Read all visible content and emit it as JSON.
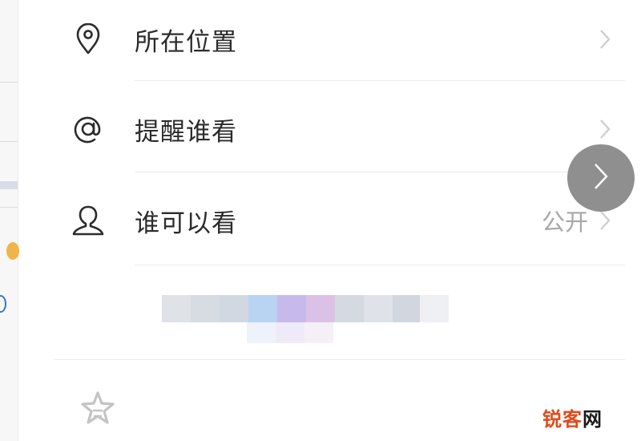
{
  "menu": {
    "location": {
      "label": "所在位置"
    },
    "mention": {
      "label": "提醒谁看"
    },
    "visibility": {
      "label": "谁可以看",
      "value": "公开"
    }
  },
  "floating_button": {
    "icon": "chevron-right-icon"
  },
  "blurred_content": {
    "row1_colors": [
      "#dfe2e7",
      "#d7dbe2",
      "#d2d8e1",
      "#b9d3f3",
      "#c8b9ec",
      "#dcc1e6",
      "#d5d9e0",
      "#dfe2e8",
      "#d2d7df",
      "#eef0f3"
    ],
    "row2_colors": [
      "#eef3fb",
      "#efeaf8",
      "#f5eff6"
    ]
  },
  "watermark": {
    "part1": "锐客",
    "part2": "网"
  },
  "colors": {
    "text": "#2b2b2b",
    "value_text": "#a8a8a8",
    "chevron": "#cfcfcf",
    "divider": "#ececec",
    "floating_button": "#8f8f8f",
    "watermark": "#e24a1a"
  }
}
